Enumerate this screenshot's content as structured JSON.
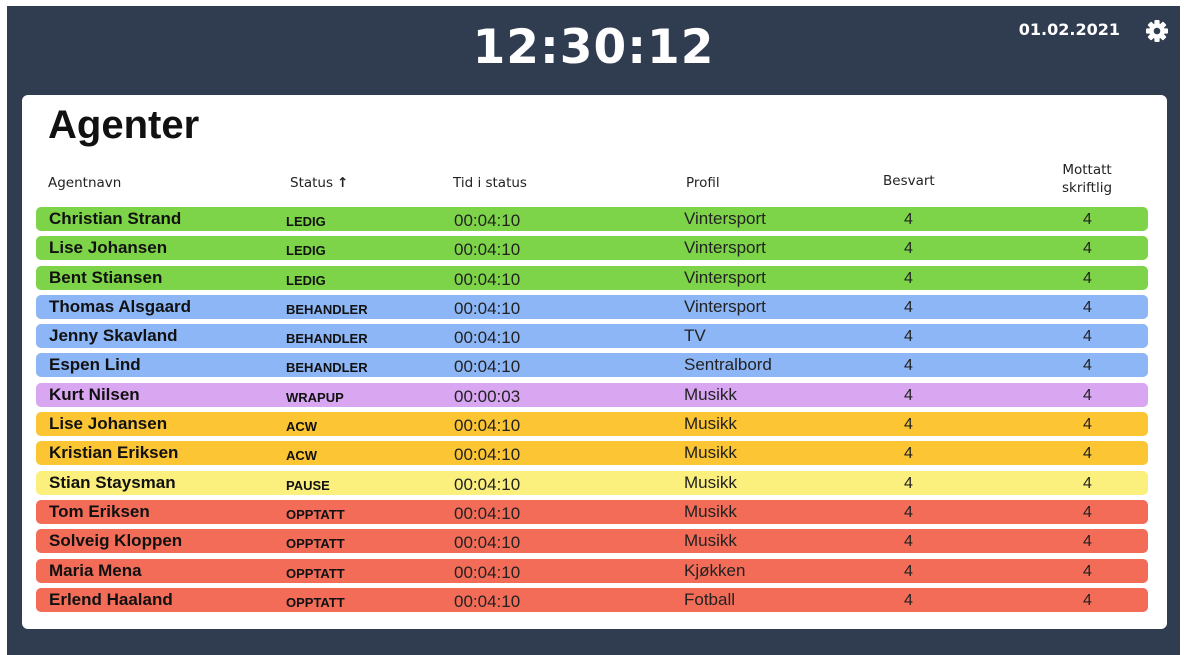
{
  "header": {
    "clock": "12:30:12",
    "date": "01.02.2021",
    "settings_icon": "gear-icon"
  },
  "panel": {
    "title": "Agenter",
    "columns": {
      "name": "Agentnavn",
      "status": "Status",
      "status_sort_icon": "arrow-up-icon",
      "time": "Tid i status",
      "profile": "Profil",
      "answered": "Besvart",
      "received_written_1": "Mottatt",
      "received_written_2": "skriftlig"
    }
  },
  "status_colors": {
    "LEDIG": "#7ed448",
    "BEHANDLER": "#8db6f6",
    "WRAPUP": "#d9a6f2",
    "ACW": "#fbc533",
    "PAUSE": "#fbf07e",
    "OPPTATT": "#f26c58"
  },
  "agents": [
    {
      "name": "Christian Strand",
      "status": "LEDIG",
      "time": "00:04:10",
      "profile": "Vintersport",
      "answered": "4",
      "received": "4"
    },
    {
      "name": "Lise Johansen",
      "status": "LEDIG",
      "time": "00:04:10",
      "profile": "Vintersport",
      "answered": "4",
      "received": "4"
    },
    {
      "name": "Bent Stiansen",
      "status": "LEDIG",
      "time": "00:04:10",
      "profile": "Vintersport",
      "answered": "4",
      "received": "4"
    },
    {
      "name": "Thomas Alsgaard",
      "status": "BEHANDLER",
      "time": "00:04:10",
      "profile": "Vintersport",
      "answered": "4",
      "received": "4"
    },
    {
      "name": "Jenny Skavland",
      "status": "BEHANDLER",
      "time": "00:04:10",
      "profile": "TV",
      "answered": "4",
      "received": "4"
    },
    {
      "name": "Espen Lind",
      "status": "BEHANDLER",
      "time": "00:04:10",
      "profile": "Sentralbord",
      "answered": "4",
      "received": "4"
    },
    {
      "name": "Kurt Nilsen",
      "status": "WRAPUP",
      "time": "00:00:03",
      "profile": "Musikk",
      "answered": "4",
      "received": "4"
    },
    {
      "name": "Lise Johansen",
      "status": "ACW",
      "time": "00:04:10",
      "profile": "Musikk",
      "answered": "4",
      "received": "4"
    },
    {
      "name": "Kristian Eriksen",
      "status": "ACW",
      "time": "00:04:10",
      "profile": "Musikk",
      "answered": "4",
      "received": "4"
    },
    {
      "name": "Stian Staysman",
      "status": "PAUSE",
      "time": "00:04:10",
      "profile": "Musikk",
      "answered": "4",
      "received": "4"
    },
    {
      "name": "Tom Eriksen",
      "status": "OPPTATT",
      "time": "00:04:10",
      "profile": "Musikk",
      "answered": "4",
      "received": "4"
    },
    {
      "name": "Solveig Kloppen",
      "status": "OPPTATT",
      "time": "00:04:10",
      "profile": "Musikk",
      "answered": "4",
      "received": "4"
    },
    {
      "name": "Maria Mena",
      "status": "OPPTATT",
      "time": "00:04:10",
      "profile": "Kjøkken",
      "answered": "4",
      "received": "4"
    },
    {
      "name": "Erlend Haaland",
      "status": "OPPTATT",
      "time": "00:04:10",
      "profile": "Fotball",
      "answered": "4",
      "received": "4"
    }
  ]
}
